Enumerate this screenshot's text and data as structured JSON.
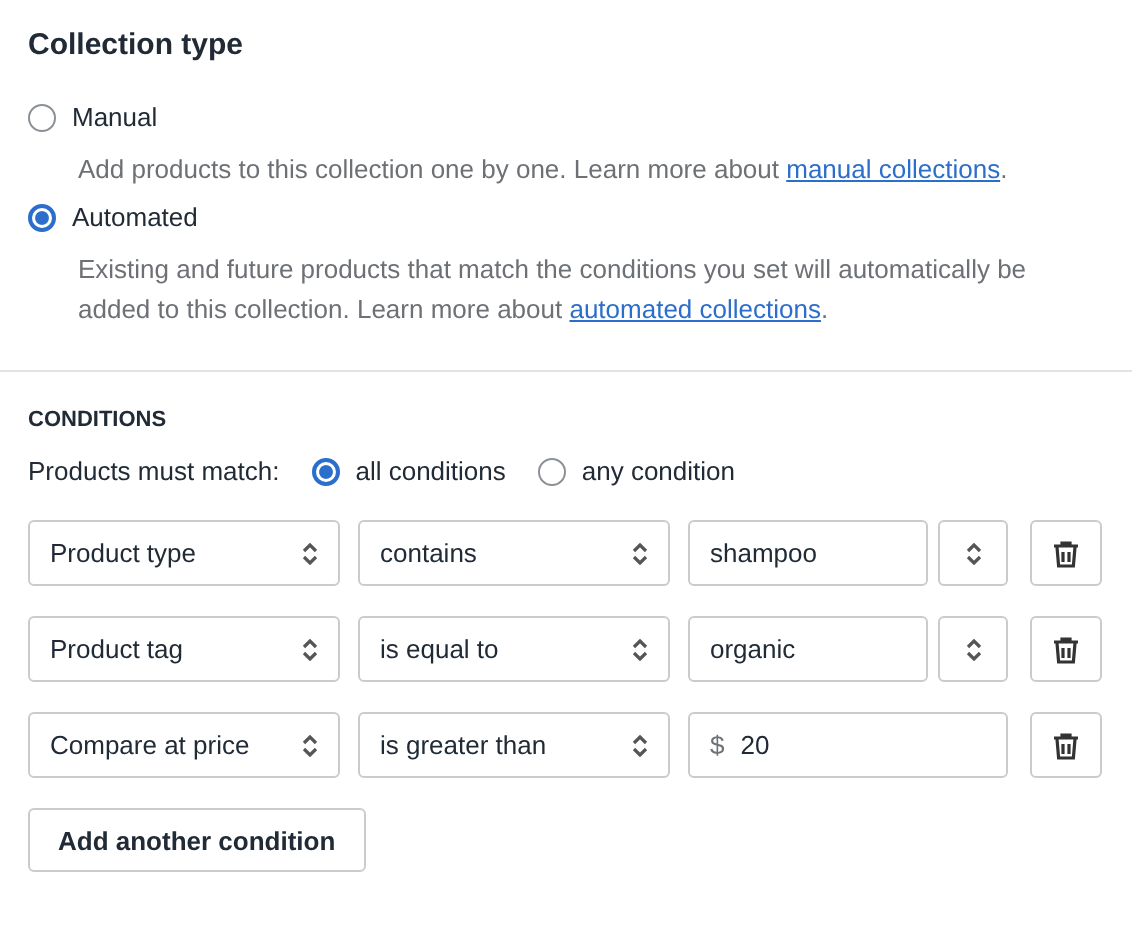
{
  "collection_type": {
    "title": "Collection type",
    "options": [
      {
        "label": "Manual",
        "selected": false,
        "description": "Add products to this collection one by one. Learn more about ",
        "link": "manual collections",
        "after": "."
      },
      {
        "label": "Automated",
        "selected": true,
        "description": "Existing and future products that match the conditions you set will automatically be added to this collection. Learn more about ",
        "link": "automated collections",
        "after": "."
      }
    ]
  },
  "conditions": {
    "heading": "CONDITIONS",
    "match_label": "Products must match:",
    "match_options": [
      {
        "label": "all conditions",
        "selected": true
      },
      {
        "label": "any condition",
        "selected": false
      }
    ],
    "rows": [
      {
        "field": "Product type",
        "operator": "contains",
        "kind": "select_value",
        "value": "shampoo"
      },
      {
        "field": "Product tag",
        "operator": "is equal to",
        "kind": "select_value",
        "value": "organic"
      },
      {
        "field": "Compare at price",
        "operator": "is greater than",
        "kind": "prefixed",
        "prefix": "$",
        "value": "20"
      }
    ],
    "add_button": "Add another condition"
  }
}
